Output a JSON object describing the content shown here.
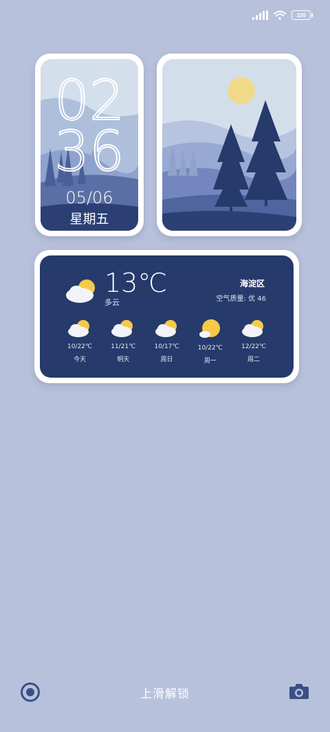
{
  "status_bar": {
    "battery": "100"
  },
  "clock": {
    "hour": "02",
    "minute": "36",
    "date": "05/06",
    "weekday": "星期五"
  },
  "weather": {
    "temp": "13℃",
    "condition": "多云",
    "district": "海淀区",
    "aqi": "空气质量: 优 46",
    "forecast": [
      {
        "range": "10/22℃",
        "day": "今天",
        "icon": "partly-cloudy-icon"
      },
      {
        "range": "11/21℃",
        "day": "明天",
        "icon": "partly-cloudy-icon"
      },
      {
        "range": "10/17℃",
        "day": "周日",
        "icon": "partly-cloudy-icon"
      },
      {
        "range": "10/22℃",
        "day": "周一",
        "icon": "sunny-icon"
      },
      {
        "range": "12/22℃",
        "day": "周二",
        "icon": "partly-cloudy-icon"
      }
    ]
  },
  "bottom": {
    "unlock_label": "上滑解锁"
  },
  "colors": {
    "background": "#b7c1db",
    "weather_card": "#263a6b",
    "sun": "#f7c948"
  }
}
